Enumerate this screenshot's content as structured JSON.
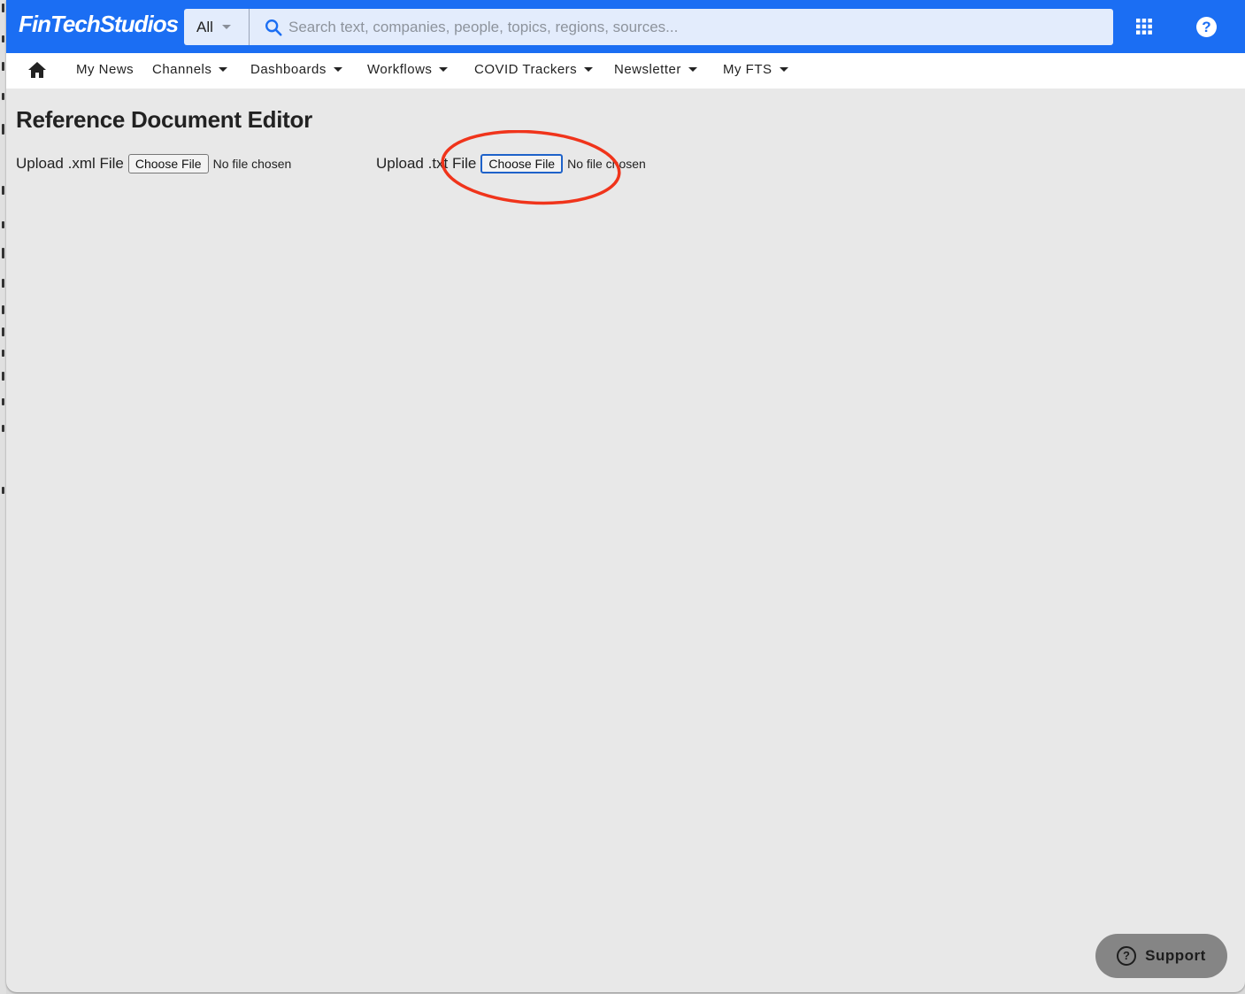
{
  "header": {
    "logo": "FinTechStudios",
    "scope_selected": "All",
    "search_placeholder": "Search text, companies, people, topics, regions, sources...",
    "search_value": "",
    "icons": [
      "search-icon",
      "apps-grid-icon",
      "help-icon"
    ]
  },
  "nav": {
    "home_icon": "home-icon",
    "items": [
      {
        "label": "My News",
        "has_dropdown": false
      },
      {
        "label": "Channels",
        "has_dropdown": true
      },
      {
        "label": "Dashboards",
        "has_dropdown": true
      },
      {
        "label": "Workflows",
        "has_dropdown": true
      },
      {
        "label": "COVID Trackers",
        "has_dropdown": true
      },
      {
        "label": "Newsletter",
        "has_dropdown": true
      },
      {
        "label": "My FTS",
        "has_dropdown": true
      }
    ]
  },
  "page": {
    "title": "Reference Document Editor",
    "uploads": [
      {
        "label": "Upload .xml File",
        "button": "Choose File",
        "status": "No file chosen"
      },
      {
        "label": "Upload .txt File",
        "button": "Choose File",
        "status": "No file chosen"
      }
    ]
  },
  "annotation": {
    "color": "#f0341b",
    "target": "txt-choose-file-button"
  },
  "support": {
    "label": "Support",
    "icon": "question-circle-icon"
  },
  "colors": {
    "brand": "#1b6ef3",
    "background": "#e8e8e8"
  }
}
